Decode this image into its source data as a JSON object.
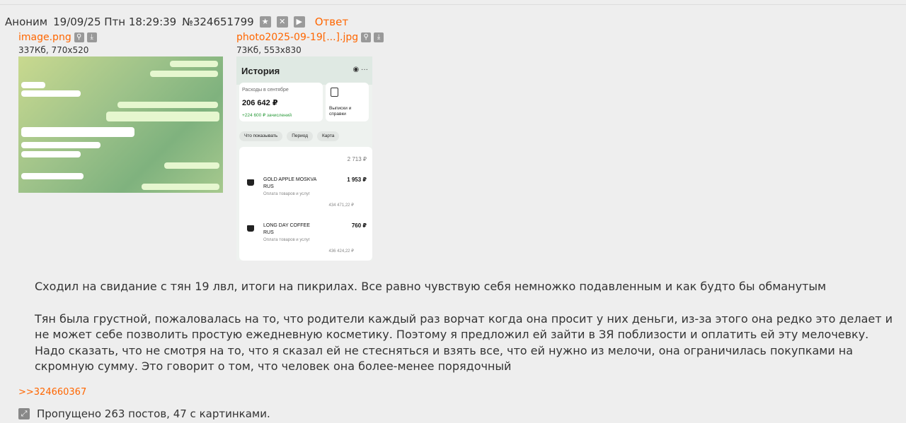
{
  "post": {
    "author": "Аноним",
    "date": "19/09/25 Птн 18:29:39",
    "number": "№324651799",
    "reply_label": "Ответ",
    "header_icons": [
      "star-icon",
      "close-icon",
      "play-icon"
    ]
  },
  "files": [
    {
      "name": "image.png",
      "info": "337Кб, 770x520",
      "icons": [
        "search-icon",
        "download-icon"
      ]
    },
    {
      "name": "photo2025-09-19[...].jpg",
      "info": "73Кб, 553x830",
      "icons": [
        "search-icon",
        "download-icon"
      ]
    }
  ],
  "screenshot2": {
    "title": "История",
    "spend_label": "Расходы в сентябре",
    "spend_amount": "206 642 ₽",
    "credited": "+224 600 ₽ зачислений",
    "statements": "Выписки и справки",
    "chips": [
      "Что показывать",
      "Период",
      "Карта"
    ],
    "total": "2 713 ₽",
    "transactions": [
      {
        "name": "GOLD APPLE MOSKVA RUS",
        "amount": "1 953 ₽",
        "category": "Оплата товаров и услуг",
        "balance": "434 471,22 ₽"
      },
      {
        "name": "LONG DAY COFFEE RUS",
        "amount": "760 ₽",
        "category": "Оплата товаров и услуг",
        "balance": "436 424,22 ₽"
      }
    ]
  },
  "message": {
    "paragraph1": "Сходил на свидание с тян 19 лвл, итоги на пикрилах. Все равно чувствую себя немножко подавленным и как будто бы обманутым",
    "paragraph2": "Тян была грустной, пожаловалась на то, что родители каждый раз ворчат когда она просит у них деньги, из-за этого она редко это делает и не может себе позволить простую ежедневную косметику. Поэтому я предложил ей зайти в ЗЯ поблизости и оплатить ей эту мелочевку. Надо сказать, что не смотря на то, что я сказал ей не стесняться и взять все, что ей нужно из мелочи, она ограничилась покупками на скромную сумму. Это говорит о том, что человек она более-менее порядочный"
  },
  "reply_ref": ">>324660367",
  "skipped": "Пропущено 263 постов, 47 с картинками.",
  "colors": {
    "accent": "#ff6600",
    "background": "#eeeeee",
    "text": "#333333"
  }
}
